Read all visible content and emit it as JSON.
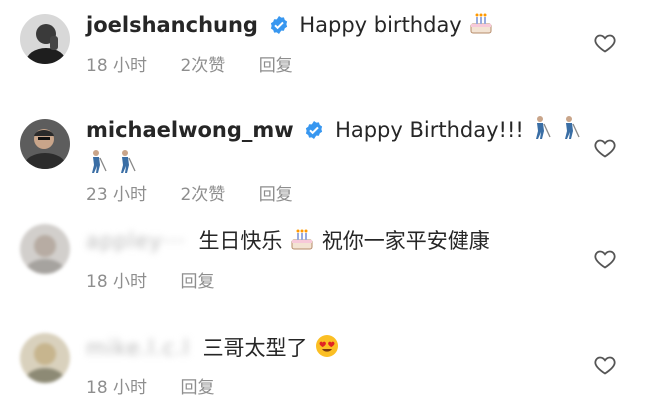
{
  "comments": [
    {
      "username": "joelshanchung",
      "verified": true,
      "text": "Happy birthday",
      "emojis": [
        "birthday-cake"
      ],
      "time": "18 小时",
      "likes": "2次赞",
      "reply": "回复"
    },
    {
      "username": "michaelwong_mw",
      "verified": true,
      "text": "Happy Birthday!!!",
      "emojis": [
        "golfer",
        "golfer",
        "golfer",
        "golfer"
      ],
      "time": "23 小时",
      "likes": "2次赞",
      "reply": "回复"
    },
    {
      "username": "appley···",
      "username_blurred": true,
      "text_before": "生日快乐",
      "text_after": "祝你一家平安健康",
      "emojis": [
        "birthday-cake"
      ],
      "time": "18 小时",
      "reply": "回复"
    },
    {
      "username": "mike.l.c.l",
      "username_blurred": true,
      "text": "三哥太型了",
      "emojis": [
        "heart-eyes-face"
      ],
      "time": "18 小时",
      "reply": "回复"
    }
  ],
  "colors": {
    "verified": "#3897f0",
    "meta": "#8e8e8e",
    "text": "#262626",
    "heart_emoji": "#fbbf24"
  }
}
